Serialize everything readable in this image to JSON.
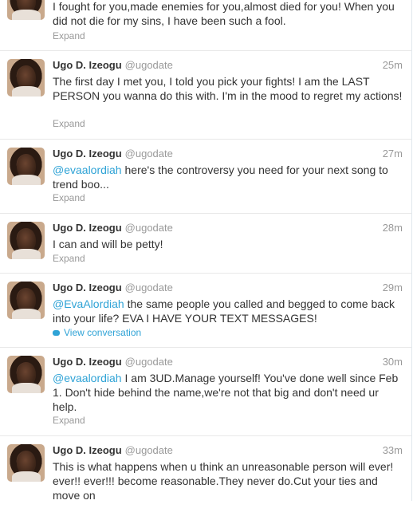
{
  "tweets": [
    {
      "text": "I fought for you,made enemies for you,almost died for you! When you did not die for my sins, I have been such a fool.",
      "action": "Expand"
    },
    {
      "name": "Ugo D. Izeogu",
      "handle": "@ugodate",
      "time": "25m",
      "text": "The first day I met you, I told you pick your fights! I am the LAST PERSON you wanna do this with. I'm in the mood to regret my actions!",
      "action": "Expand"
    },
    {
      "name": "Ugo D. Izeogu",
      "handle": "@ugodate",
      "time": "27m",
      "mention": "@evaalordiah",
      "text": " here's the controversy you need for your next song to trend boo...",
      "action": "Expand"
    },
    {
      "name": "Ugo D. Izeogu",
      "handle": "@ugodate",
      "time": "28m",
      "text": "I can and will be petty!",
      "action": "Expand"
    },
    {
      "name": "Ugo D. Izeogu",
      "handle": "@ugodate",
      "time": "29m",
      "mention": "@EvaAlordiah",
      "text": " the same people you called and begged to come back into your life? EVA I HAVE YOUR TEXT MESSAGES!",
      "action": "View conversation"
    },
    {
      "name": "Ugo D. Izeogu",
      "handle": "@ugodate",
      "time": "30m",
      "mention": "@evaalordiah",
      "text": " I am 3UD.Manage yourself! You've done well since Feb 1. Don't hide behind the name,we're not that big and don't need ur help.",
      "action": "Expand"
    },
    {
      "name": "Ugo D. Izeogu",
      "handle": "@ugodate",
      "time": "33m",
      "text": "This is what happens when u think an unreasonable person will ever! ever!! ever!!! become reasonable.They never do.Cut your ties and move on"
    }
  ]
}
